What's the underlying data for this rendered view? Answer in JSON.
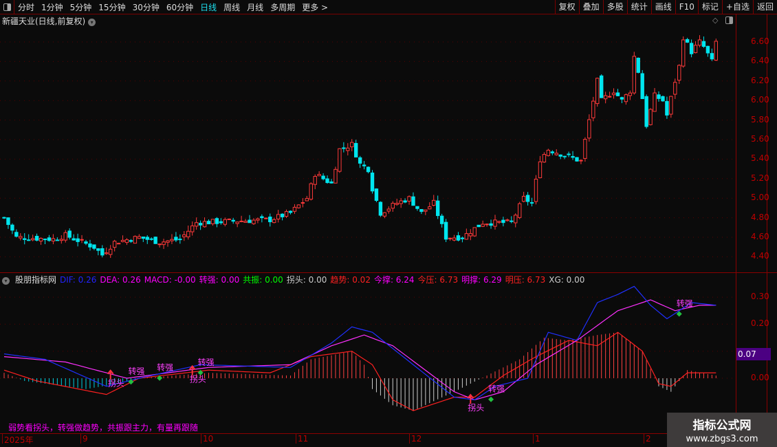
{
  "toolbar": {
    "periods": [
      "分时",
      "1分钟",
      "5分钟",
      "15分钟",
      "30分钟",
      "60分钟",
      "日线",
      "周线",
      "月线",
      "多周期",
      "更多 >"
    ],
    "active": "日线",
    "right": [
      "复权",
      "叠加",
      "多股",
      "统计",
      "画线",
      "F10",
      "标记",
      "+自选",
      "返回"
    ]
  },
  "chart": {
    "title": "新疆天业(日线,前复权)",
    "y_labels": [
      "6.60",
      "6.40",
      "6.20",
      "6.00",
      "5.80",
      "5.60",
      "5.40",
      "5.20",
      "5.00",
      "4.80",
      "4.60",
      "4.40"
    ],
    "price_path": [
      [
        0,
        4.8
      ],
      [
        3,
        4.6
      ],
      [
        12,
        4.58
      ],
      [
        15,
        4.62
      ],
      [
        22,
        4.5
      ],
      [
        24,
        4.42
      ],
      [
        27,
        4.55
      ],
      [
        33,
        4.6
      ],
      [
        38,
        4.55
      ],
      [
        43,
        4.58
      ],
      [
        47,
        4.75
      ],
      [
        65,
        4.78
      ],
      [
        70,
        4.85
      ],
      [
        74,
        5.0
      ],
      [
        76,
        5.25
      ],
      [
        80,
        5.15
      ],
      [
        82,
        5.5
      ],
      [
        85,
        5.55
      ],
      [
        87,
        5.35
      ],
      [
        89,
        5.3
      ],
      [
        90,
        5.1
      ],
      [
        92,
        4.85
      ],
      [
        96,
        4.95
      ],
      [
        99,
        5.0
      ],
      [
        102,
        4.85
      ],
      [
        105,
        4.95
      ],
      [
        108,
        4.6
      ],
      [
        112,
        4.6
      ],
      [
        117,
        4.75
      ],
      [
        124,
        4.75
      ],
      [
        127,
        5.0
      ],
      [
        129,
        4.95
      ],
      [
        131,
        5.4
      ],
      [
        133,
        5.5
      ],
      [
        141,
        5.38
      ],
      [
        143,
        5.8
      ],
      [
        145,
        6.2
      ],
      [
        146,
        6.0
      ],
      [
        149,
        6.1
      ],
      [
        151,
        6.0
      ],
      [
        153,
        6.1
      ],
      [
        154,
        6.45
      ],
      [
        155,
        6.3
      ],
      [
        157,
        5.75
      ],
      [
        159,
        6.05
      ],
      [
        161,
        6.0
      ],
      [
        162,
        5.85
      ],
      [
        164,
        6.2
      ],
      [
        165,
        6.35
      ],
      [
        166,
        6.65
      ],
      [
        168,
        6.5
      ],
      [
        170,
        6.6
      ],
      [
        171,
        6.55
      ],
      [
        173,
        6.4
      ],
      [
        174,
        6.6
      ]
    ]
  },
  "indicator": {
    "name": "股朋指标网",
    "values": [
      {
        "label": "DIF: 0.26",
        "color": "#2222ff"
      },
      {
        "label": "DEA: 0.26",
        "color": "#ff00ff"
      },
      {
        "label": "MACD: -0.00",
        "color": "#ff00ff"
      },
      {
        "label": "转强: 0.00",
        "color": "#ff00ff"
      },
      {
        "label": "共振: 0.00",
        "color": "#00ff00"
      },
      {
        "label": "拐头: 0.00",
        "color": "#cccccc"
      },
      {
        "label": "趋势: 0.02",
        "color": "#ff2020"
      },
      {
        "label": "今撑: 6.24",
        "color": "#ff00ff"
      },
      {
        "label": "今压: 6.73",
        "color": "#ff2020"
      },
      {
        "label": "明撑: 6.29",
        "color": "#ff00ff"
      },
      {
        "label": "明压: 6.73",
        "color": "#ff2020"
      },
      {
        "label": "XG: 0.00",
        "color": "#cccccc"
      }
    ],
    "y_labels": [
      "0.30",
      "0.20",
      "0.00"
    ],
    "cursor_value": "0.07",
    "dif": [
      [
        0,
        0.09
      ],
      [
        10,
        0.07
      ],
      [
        25,
        -0.03
      ],
      [
        33,
        0.0
      ],
      [
        48,
        0.05
      ],
      [
        70,
        0.04
      ],
      [
        80,
        0.13
      ],
      [
        85,
        0.19
      ],
      [
        90,
        0.17
      ],
      [
        100,
        0.05
      ],
      [
        110,
        -0.07
      ],
      [
        115,
        -0.08
      ],
      [
        120,
        -0.03
      ],
      [
        128,
        0.0
      ],
      [
        133,
        0.17
      ],
      [
        140,
        0.14
      ],
      [
        145,
        0.28
      ],
      [
        150,
        0.31
      ],
      [
        154,
        0.34
      ],
      [
        158,
        0.27
      ],
      [
        162,
        0.22
      ],
      [
        168,
        0.28
      ],
      [
        174,
        0.27
      ]
    ],
    "dea": [
      [
        0,
        0.08
      ],
      [
        15,
        0.06
      ],
      [
        30,
        0.0
      ],
      [
        50,
        0.04
      ],
      [
        70,
        0.05
      ],
      [
        80,
        0.12
      ],
      [
        88,
        0.16
      ],
      [
        95,
        0.12
      ],
      [
        110,
        -0.05
      ],
      [
        115,
        -0.08
      ],
      [
        122,
        -0.05
      ],
      [
        130,
        0.05
      ],
      [
        140,
        0.14
      ],
      [
        150,
        0.25
      ],
      [
        158,
        0.29
      ],
      [
        164,
        0.25
      ],
      [
        170,
        0.27
      ],
      [
        174,
        0.27
      ]
    ],
    "trend": [
      [
        0,
        0.03
      ],
      [
        8,
        -0.01
      ],
      [
        25,
        -0.06
      ],
      [
        33,
        0.0
      ],
      [
        50,
        0.03
      ],
      [
        65,
        0.02
      ],
      [
        75,
        0.08
      ],
      [
        85,
        0.1
      ],
      [
        90,
        0.05
      ],
      [
        95,
        -0.08
      ],
      [
        100,
        -0.12
      ],
      [
        110,
        -0.07
      ],
      [
        115,
        -0.07
      ],
      [
        122,
        0.01
      ],
      [
        130,
        0.08
      ],
      [
        138,
        0.14
      ],
      [
        145,
        0.12
      ],
      [
        150,
        0.17
      ],
      [
        156,
        0.1
      ],
      [
        160,
        -0.02
      ],
      [
        163,
        -0.03
      ],
      [
        167,
        0.02
      ],
      [
        174,
        0.02
      ]
    ],
    "hist": [
      [
        0,
        0.02
      ],
      [
        5,
        -0.01
      ],
      [
        20,
        -0.04
      ],
      [
        28,
        -0.02
      ],
      [
        33,
        0.0
      ],
      [
        50,
        0.02
      ],
      [
        70,
        0.01
      ],
      [
        75,
        0.07
      ],
      [
        85,
        0.1
      ],
      [
        88,
        0.05
      ],
      [
        90,
        -0.04
      ],
      [
        95,
        -0.1
      ],
      [
        100,
        -0.12
      ],
      [
        110,
        -0.05
      ],
      [
        118,
        0.01
      ],
      [
        126,
        0.07
      ],
      [
        132,
        0.15
      ],
      [
        138,
        0.14
      ],
      [
        145,
        0.16
      ],
      [
        150,
        0.17
      ],
      [
        156,
        0.1
      ],
      [
        160,
        -0.03
      ],
      [
        163,
        -0.05
      ],
      [
        167,
        0.03
      ],
      [
        174,
        0.01
      ]
    ],
    "signals": [
      {
        "i": 26,
        "label": "拐头",
        "type": "down"
      },
      {
        "i": 31,
        "label": "转强",
        "type": "up"
      },
      {
        "i": 38,
        "label": "转强",
        "type": "up"
      },
      {
        "i": 46,
        "label": "拐头",
        "type": "down"
      },
      {
        "i": 48,
        "label": "转强",
        "type": "up"
      },
      {
        "i": 114,
        "label": "拐头",
        "type": "down"
      },
      {
        "i": 119,
        "label": "转强",
        "type": "up"
      },
      {
        "i": 165,
        "label": "转强",
        "type": "up"
      }
    ],
    "note": "弱势看拐头，转强做趋势，共振跟主力，有量再跟随"
  },
  "time_axis": [
    "2025年",
    "9",
    "10",
    "11",
    "12",
    "1",
    "2"
  ],
  "watermark": {
    "title": "指标公式网",
    "url": "www.zbgs3.com"
  },
  "colors": {
    "up": "#ff3a3a",
    "down": "#00e5ee",
    "axis": "#8b0000"
  }
}
